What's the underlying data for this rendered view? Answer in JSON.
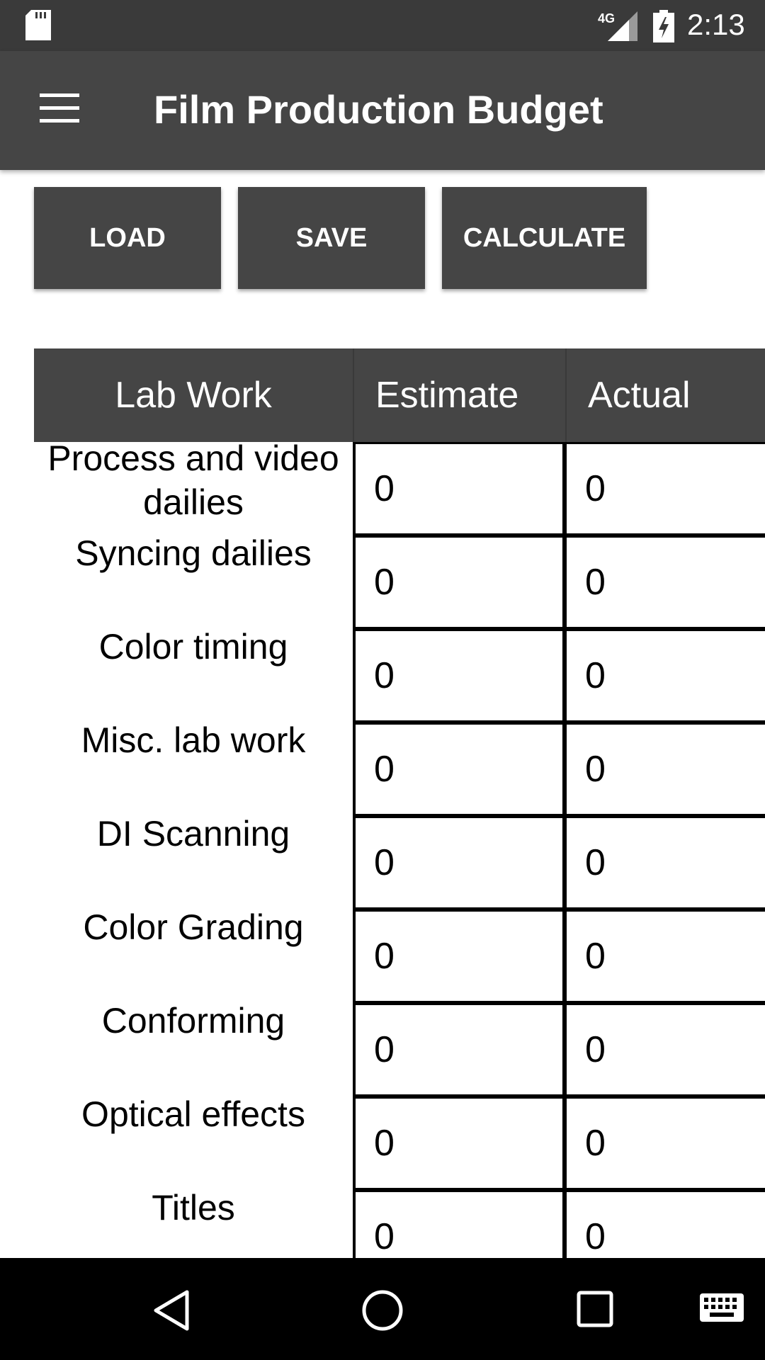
{
  "status_bar": {
    "network": "4G",
    "time": "2:13",
    "icons": [
      "sd-card-icon",
      "signal-icon",
      "battery-charging-icon"
    ]
  },
  "app_bar": {
    "menu_icon": "menu-icon",
    "title": "Film Production Budget"
  },
  "toolbar": {
    "load_label": "LOAD",
    "save_label": "SAVE",
    "calculate_label": "CALCULATE"
  },
  "table": {
    "headers": [
      "Lab Work",
      "Estimate",
      "Actual"
    ],
    "rows": [
      {
        "label": "Process and video dailies",
        "estimate": "0",
        "actual": "0"
      },
      {
        "label": "Syncing dailies",
        "estimate": "0",
        "actual": "0"
      },
      {
        "label": "Color timing",
        "estimate": "0",
        "actual": "0"
      },
      {
        "label": "Misc. lab work",
        "estimate": "0",
        "actual": "0"
      },
      {
        "label": "DI Scanning",
        "estimate": "0",
        "actual": "0"
      },
      {
        "label": "Color Grading",
        "estimate": "0",
        "actual": "0"
      },
      {
        "label": "Conforming",
        "estimate": "0",
        "actual": "0"
      },
      {
        "label": "Optical effects",
        "estimate": "0",
        "actual": "0"
      },
      {
        "label": "Titles",
        "estimate": "0",
        "actual": "0"
      }
    ]
  },
  "nav_bar": {
    "icons": [
      "back-icon",
      "home-icon",
      "recent-apps-icon",
      "keyboard-icon"
    ]
  },
  "colors": {
    "status_bar": "#3a3a3a",
    "app_bar": "#454545",
    "button": "#454545",
    "header": "#454545",
    "nav_bar": "#000000"
  }
}
